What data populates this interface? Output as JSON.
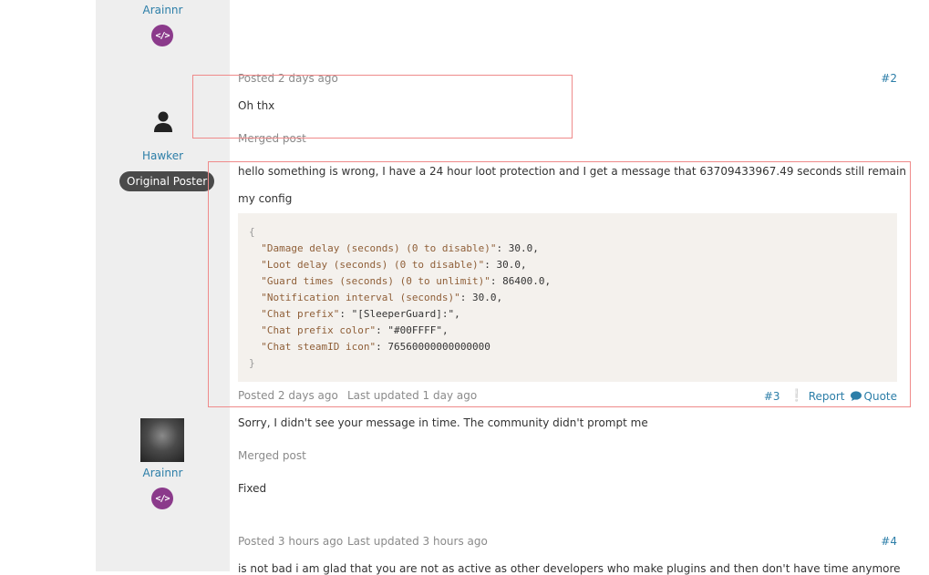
{
  "posts": [
    {
      "author": "Arainnr",
      "badge": "</>"
    },
    {
      "posted": "Posted 2 days ago",
      "number": "#2",
      "text": "Oh thx",
      "merged_label": "Merged post",
      "author": "Hawker",
      "role_badge": "Original Poster",
      "merged_text": "hello something is wrong, I have a 24 hour loot protection and I get a message that 63709433967.49 seconds still remain",
      "config_label": "my config",
      "code": {
        "open": "{",
        "lines": [
          {
            "key": "\"Damage delay (seconds) (0 to disable)\"",
            "value": "30.0,"
          },
          {
            "key": "\"Loot delay (seconds) (0 to disable)\"",
            "value": "30.0,"
          },
          {
            "key": "\"Guard times (seconds) (0 to unlimit)\"",
            "value": "86400.0,"
          },
          {
            "key": "\"Notification interval (seconds)\"",
            "value": "30.0,"
          },
          {
            "key": "\"Chat prefix\"",
            "value": "\"[SleeperGuard]:\","
          },
          {
            "key": "\"Chat prefix color\"",
            "value": "\"#00FFFF\","
          },
          {
            "key": "\"Chat steamID icon\"",
            "value": "76560000000000000"
          }
        ],
        "close": "}"
      },
      "footer": {
        "posted": "Posted 2 days ago",
        "updated": "Last updated 1 day ago",
        "number": "#3",
        "report": "Report",
        "quote": "Quote"
      }
    },
    {
      "author": "Arainnr",
      "badge": "</>",
      "text": "Sorry, I didn't see your message in time. The community didn't prompt me",
      "merged_label": "Merged post",
      "merged_text": "Fixed"
    },
    {
      "posted": "Posted 3 hours ago",
      "updated": "Last updated 3 hours ago",
      "number": "#4",
      "text": "is not bad i am glad that you are not as active as other developers who make plugins and then don't have time anymore"
    }
  ]
}
